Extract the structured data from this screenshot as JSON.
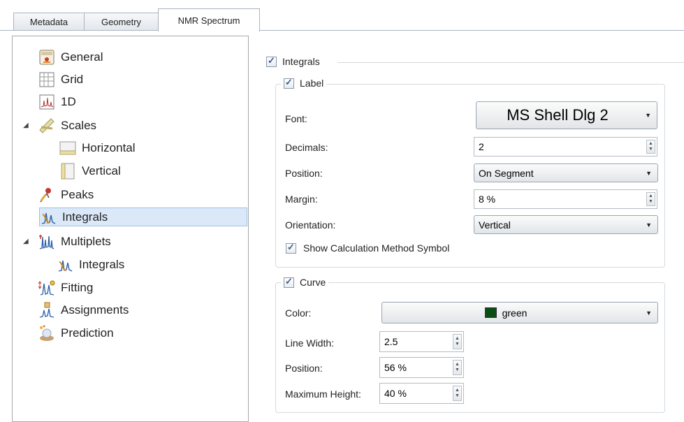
{
  "tabs": [
    {
      "label": "Metadata"
    },
    {
      "label": "Geometry"
    },
    {
      "label": "NMR Spectrum"
    }
  ],
  "tree": {
    "items": [
      {
        "label": "General",
        "icon": "title-icon"
      },
      {
        "label": "Grid",
        "icon": "grid-icon"
      },
      {
        "label": "1D",
        "icon": "spectrum-1d-icon"
      },
      {
        "label": "Scales",
        "icon": "ruler-icon"
      },
      {
        "label": "Horizontal",
        "icon": "horizontal-ruler-icon"
      },
      {
        "label": "Vertical",
        "icon": "vertical-ruler-icon"
      },
      {
        "label": "Peaks",
        "icon": "peaks-icon"
      },
      {
        "label": "Integrals",
        "icon": "integrals-icon"
      },
      {
        "label": "Multiplets",
        "icon": "multiplets-icon"
      },
      {
        "label": "Integrals",
        "icon": "integrals-icon"
      },
      {
        "label": "Fitting",
        "icon": "fitting-icon"
      },
      {
        "label": "Assignments",
        "icon": "assignments-icon"
      },
      {
        "label": "Prediction",
        "icon": "prediction-icon"
      }
    ]
  },
  "integrals": {
    "title": "Integrals",
    "label_group": {
      "title": "Label",
      "font_label": "Font:",
      "font_value": "MS Shell Dlg 2",
      "decimals_label": "Decimals:",
      "decimals_value": "2",
      "position_label": "Position:",
      "position_value": "On Segment",
      "margin_label": "Margin:",
      "margin_value": "8 %",
      "orientation_label": "Orientation:",
      "orientation_value": "Vertical",
      "show_symbol_label": "Show Calculation Method Symbol"
    },
    "curve_group": {
      "title": "Curve",
      "color_label": "Color:",
      "color_value": "green",
      "color_swatch": "#0b4d12",
      "line_width_label": "Line Width:",
      "line_width_value": "2.5",
      "position_label": "Position:",
      "position_value": "56 %",
      "max_height_label": "Maximum Height:",
      "max_height_value": "40 %"
    }
  }
}
